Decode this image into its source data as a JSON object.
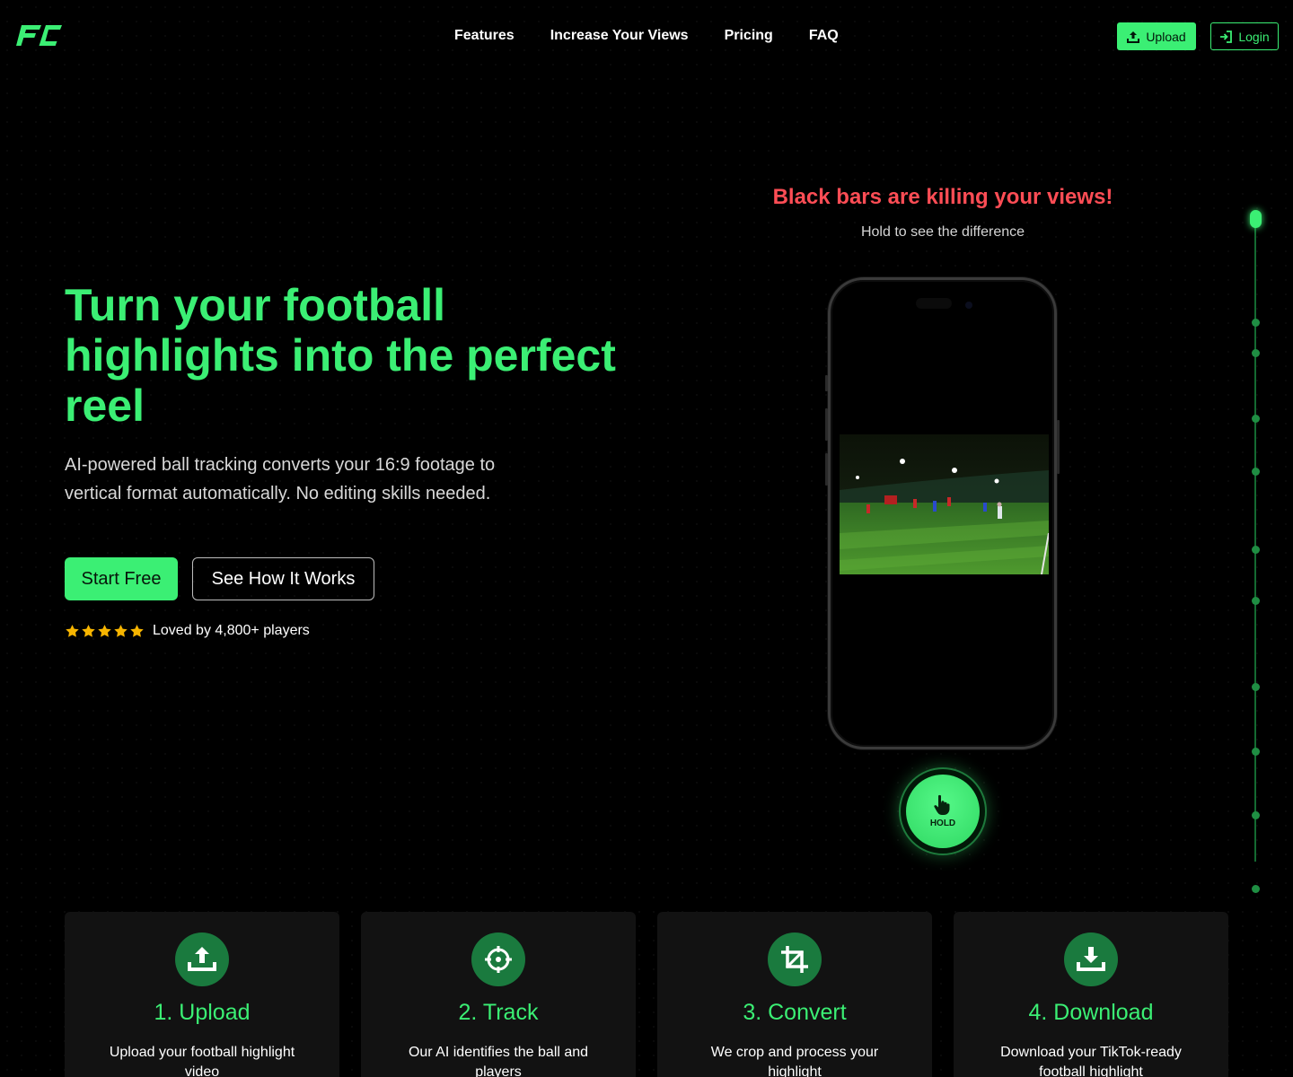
{
  "nav": {
    "logo_text": "FC",
    "links": [
      "Features",
      "Increase Your Views",
      "Pricing",
      "FAQ"
    ],
    "upload_label": "Upload",
    "login_label": "Login"
  },
  "hero": {
    "title": "Turn your football highlights into the perfect reel",
    "subtitle": "AI-powered ball tracking converts your 16:9 footage to vertical format automatically. No editing skills needed.",
    "cta_primary": "Start Free",
    "cta_secondary": "See How It Works",
    "rating_stars": 5,
    "rating_text": "Loved by 4,800+ players"
  },
  "demo": {
    "warning": "Black bars are killing your views!",
    "hint": "Hold to see the difference",
    "hold_label": "HOLD"
  },
  "steps": [
    {
      "icon": "upload-icon",
      "title": "1. Upload",
      "desc": "Upload your football highlight video"
    },
    {
      "icon": "crosshair-icon",
      "title": "2. Track",
      "desc": "Our AI identifies the ball and players"
    },
    {
      "icon": "crop-icon",
      "title": "3. Convert",
      "desc": "We crop and process your highlight"
    },
    {
      "icon": "download-icon",
      "title": "4. Download",
      "desc": "Download your TikTok-ready football highlight"
    }
  ],
  "colors": {
    "accent": "#3bef74",
    "warning": "#ff4d55",
    "background": "#000000",
    "card": "#121212"
  }
}
